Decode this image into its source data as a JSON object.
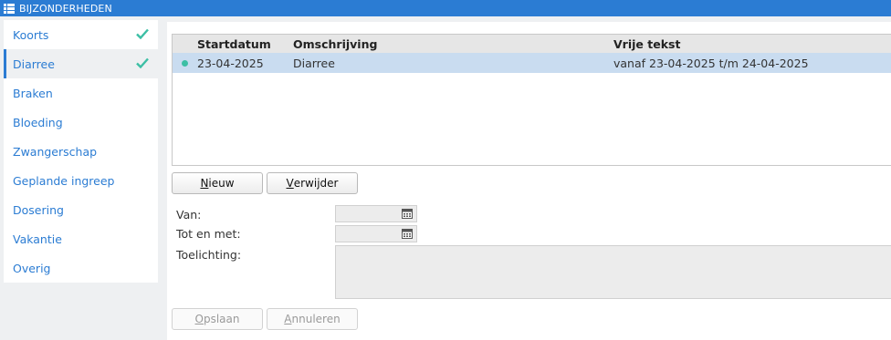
{
  "window": {
    "title": "BIJZONDERHEDEN",
    "icon": "list-icon"
  },
  "sidebar": {
    "items": [
      {
        "label": "Koorts",
        "checked": true
      },
      {
        "label": "Diarree",
        "checked": true,
        "active": true
      },
      {
        "label": "Braken"
      },
      {
        "label": "Bloeding"
      },
      {
        "label": "Zwangerschap"
      },
      {
        "label": "Geplande ingreep"
      },
      {
        "label": "Dosering"
      },
      {
        "label": "Vakantie"
      },
      {
        "label": "Overig"
      }
    ]
  },
  "grid": {
    "columns": {
      "start": "Startdatum",
      "description": "Omschrijving",
      "free_text": "Vrije tekst"
    },
    "rows": [
      {
        "start": "23-04-2025",
        "description": "Diarree",
        "free_text": "vanaf 23-04-2025 t/m 24-04-2025",
        "selected": true
      }
    ]
  },
  "buttons": {
    "new": {
      "underline": "N",
      "rest": "ieuw"
    },
    "delete": {
      "underline": "V",
      "rest": "erwijder"
    },
    "save": {
      "underline": "O",
      "rest": "pslaan"
    },
    "cancel": {
      "underline": "A",
      "rest": "nnuleren"
    }
  },
  "form": {
    "from_label": "Van:",
    "to_label": "Tot en met:",
    "note_label": "Toelichting:",
    "from_value": "",
    "to_value": "",
    "note_value": ""
  },
  "colors": {
    "accent": "#2b7cd3",
    "check": "#3cbfa5",
    "selected_row": "#c9dcf0"
  }
}
